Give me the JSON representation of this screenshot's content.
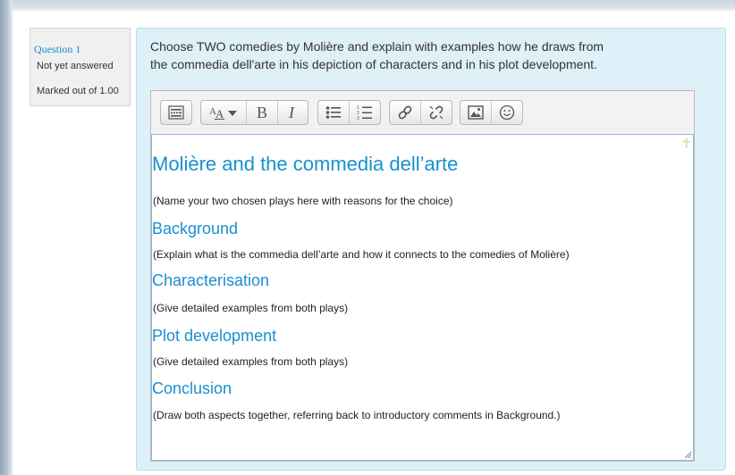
{
  "question": {
    "number_label": "Question 1",
    "state": "Not yet answered",
    "grade": "Marked out of 1.00",
    "text_line1": "Choose TWO comedies by Molière and explain with examples how he draws from",
    "text_line2": "the commedia dell'arte in his depiction of characters and in his plot development."
  },
  "toolbar": {
    "groups": [
      [
        "collapse-icon"
      ],
      [
        "font-style-icon",
        "bold-icon",
        "italic-icon"
      ],
      [
        "unordered-list-icon",
        "ordered-list-icon"
      ],
      [
        "link-icon",
        "unlink-icon"
      ],
      [
        "image-icon",
        "emoticon-icon"
      ]
    ]
  },
  "editor": {
    "anchor_glyph": "☥",
    "heading": "Molière and the commedia dell’arte",
    "intro": "(Name your two chosen plays here with reasons for the choice)",
    "background_heading": "Background",
    "background_text": "(Explain what is the commedia dell’arte and how it connects to the comedies of Molière)",
    "characterisation_heading": "Characterisation",
    "characterisation_text": "(Give detailed examples from both plays)",
    "plot_heading": "Plot development",
    "plot_text": "(Give detailed examples from both plays)",
    "conclusion_heading": "Conclusion",
    "conclusion_text": "(Draw both aspects together, referring back to introductory comments in Background.)"
  },
  "colors": {
    "accent": "#1a8fd1",
    "panel_bg": "#def0f8"
  }
}
